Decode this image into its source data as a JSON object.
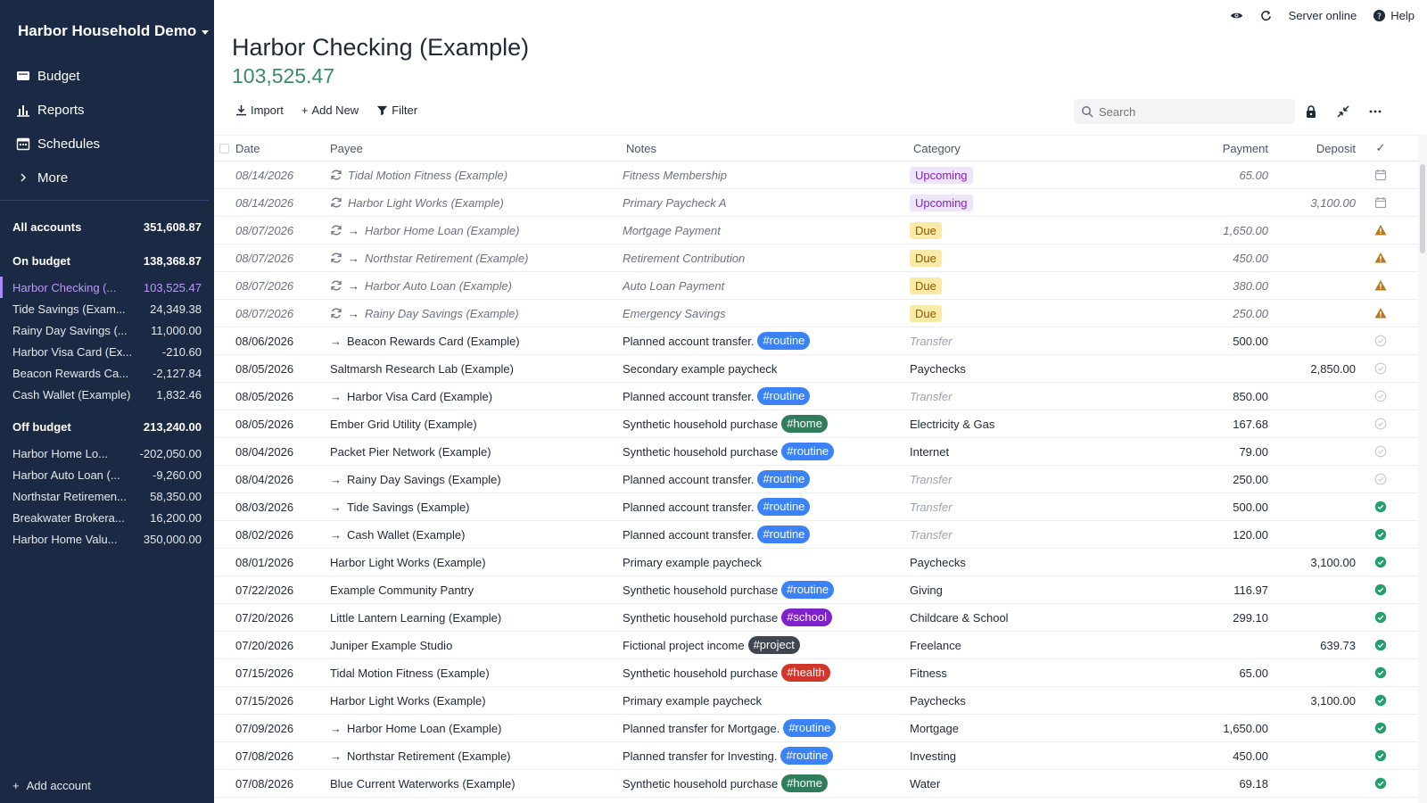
{
  "sidebar": {
    "budget_name": "Harbor Household Demo",
    "nav": [
      {
        "label": "Budget",
        "icon": "wallet-icon"
      },
      {
        "label": "Reports",
        "icon": "bar-chart-icon"
      },
      {
        "label": "Schedules",
        "icon": "calendar-icon"
      },
      {
        "label": "More",
        "icon": "chevron-right-icon"
      }
    ],
    "all_accounts": {
      "label": "All accounts",
      "balance": "351,608.87"
    },
    "on_budget": {
      "label": "On budget",
      "balance": "138,368.87"
    },
    "on_budget_accounts": [
      {
        "name": "Harbor Checking (...",
        "balance": "103,525.47",
        "selected": true
      },
      {
        "name": "Tide Savings (Exam...",
        "balance": "24,349.38"
      },
      {
        "name": "Rainy Day Savings (...",
        "balance": "11,000.00"
      },
      {
        "name": "Harbor Visa Card (Ex...",
        "balance": "-210.60"
      },
      {
        "name": "Beacon Rewards Ca...",
        "balance": "-2,127.84"
      },
      {
        "name": "Cash Wallet (Example)",
        "balance": "1,832.46"
      }
    ],
    "off_budget": {
      "label": "Off budget",
      "balance": "213,240.00"
    },
    "off_budget_accounts": [
      {
        "name": "Harbor Home Lo...",
        "balance": "-202,050.00"
      },
      {
        "name": "Harbor Auto Loan (...",
        "balance": "-9,260.00"
      },
      {
        "name": "Northstar Retiremen...",
        "balance": "58,350.00"
      },
      {
        "name": "Breakwater Brokera...",
        "balance": "16,200.00"
      },
      {
        "name": "Harbor Home Valu...",
        "balance": "350,000.00"
      }
    ],
    "add_account": "Add account"
  },
  "topbar": {
    "server_status": "Server online",
    "help": "Help"
  },
  "header": {
    "title": "Harbor Checking (Example)",
    "balance": "103,525.47"
  },
  "toolbar": {
    "import": "Import",
    "add_new": "Add New",
    "filter": "Filter",
    "search_placeholder": "Search"
  },
  "columns": {
    "date": "Date",
    "payee": "Payee",
    "notes": "Notes",
    "category": "Category",
    "payment": "Payment",
    "deposit": "Deposit",
    "cleared": "✓"
  },
  "colors": {
    "routine": "#3b82f6",
    "home": "#2f7d5b",
    "school": "#7e22ce",
    "project": "#3f4651",
    "health": "#d1362b",
    "cleared": "#22a06b",
    "warning": "#b7791f"
  },
  "rows": [
    {
      "date": "08/14/2026",
      "schedule": true,
      "transfer": false,
      "payee": "Tidal Motion Fitness (Example)",
      "notes": "Fitness Membership",
      "tag": "",
      "tag_color": "",
      "category": "Upcoming",
      "cat_type": "upcoming",
      "payment": "65.00",
      "deposit": "",
      "status": "calendar"
    },
    {
      "date": "08/14/2026",
      "schedule": true,
      "transfer": false,
      "payee": "Harbor Light Works (Example)",
      "notes": "Primary Paycheck A",
      "tag": "",
      "tag_color": "",
      "category": "Upcoming",
      "cat_type": "upcoming",
      "payment": "",
      "deposit": "3,100.00",
      "status": "calendar"
    },
    {
      "date": "08/07/2026",
      "schedule": true,
      "transfer": true,
      "payee": "Harbor Home Loan (Example)",
      "notes": "Mortgage Payment",
      "tag": "",
      "tag_color": "",
      "category": "Due",
      "cat_type": "due",
      "payment": "1,650.00",
      "deposit": "",
      "status": "warning"
    },
    {
      "date": "08/07/2026",
      "schedule": true,
      "transfer": true,
      "payee": "Northstar Retirement (Example)",
      "notes": "Retirement Contribution",
      "tag": "",
      "tag_color": "",
      "category": "Due",
      "cat_type": "due",
      "payment": "450.00",
      "deposit": "",
      "status": "warning"
    },
    {
      "date": "08/07/2026",
      "schedule": true,
      "transfer": true,
      "payee": "Harbor Auto Loan (Example)",
      "notes": "Auto Loan Payment",
      "tag": "",
      "tag_color": "",
      "category": "Due",
      "cat_type": "due",
      "payment": "380.00",
      "deposit": "",
      "status": "warning"
    },
    {
      "date": "08/07/2026",
      "schedule": true,
      "transfer": true,
      "payee": "Rainy Day Savings (Example)",
      "notes": "Emergency Savings",
      "tag": "",
      "tag_color": "",
      "category": "Due",
      "cat_type": "due",
      "payment": "250.00",
      "deposit": "",
      "status": "warning"
    },
    {
      "date": "08/06/2026",
      "schedule": false,
      "transfer": true,
      "payee": "Beacon Rewards Card (Example)",
      "notes": "Planned account transfer.",
      "tag": "#routine",
      "tag_color": "#3b82f6",
      "category": "Transfer",
      "cat_type": "transfer",
      "payment": "500.00",
      "deposit": "",
      "status": "uncleared"
    },
    {
      "date": "08/05/2026",
      "schedule": false,
      "transfer": false,
      "payee": "Saltmarsh Research Lab (Example)",
      "notes": "Secondary example paycheck",
      "tag": "",
      "tag_color": "",
      "category": "Paychecks",
      "cat_type": "normal",
      "payment": "",
      "deposit": "2,850.00",
      "status": "uncleared"
    },
    {
      "date": "08/05/2026",
      "schedule": false,
      "transfer": true,
      "payee": "Harbor Visa Card (Example)",
      "notes": "Planned account transfer.",
      "tag": "#routine",
      "tag_color": "#3b82f6",
      "category": "Transfer",
      "cat_type": "transfer",
      "payment": "850.00",
      "deposit": "",
      "status": "uncleared"
    },
    {
      "date": "08/05/2026",
      "schedule": false,
      "transfer": false,
      "payee": "Ember Grid Utility (Example)",
      "notes": "Synthetic household purchase",
      "tag": "#home",
      "tag_color": "#2f7d5b",
      "category": "Electricity & Gas",
      "cat_type": "normal",
      "payment": "167.68",
      "deposit": "",
      "status": "uncleared"
    },
    {
      "date": "08/04/2026",
      "schedule": false,
      "transfer": false,
      "payee": "Packet Pier Network (Example)",
      "notes": "Synthetic household purchase",
      "tag": "#routine",
      "tag_color": "#3b82f6",
      "category": "Internet",
      "cat_type": "normal",
      "payment": "79.00",
      "deposit": "",
      "status": "uncleared"
    },
    {
      "date": "08/04/2026",
      "schedule": false,
      "transfer": true,
      "payee": "Rainy Day Savings (Example)",
      "notes": "Planned account transfer.",
      "tag": "#routine",
      "tag_color": "#3b82f6",
      "category": "Transfer",
      "cat_type": "transfer",
      "payment": "250.00",
      "deposit": "",
      "status": "uncleared"
    },
    {
      "date": "08/03/2026",
      "schedule": false,
      "transfer": true,
      "payee": "Tide Savings (Example)",
      "notes": "Planned account transfer.",
      "tag": "#routine",
      "tag_color": "#3b82f6",
      "category": "Transfer",
      "cat_type": "transfer",
      "payment": "500.00",
      "deposit": "",
      "status": "cleared"
    },
    {
      "date": "08/02/2026",
      "schedule": false,
      "transfer": true,
      "payee": "Cash Wallet (Example)",
      "notes": "Planned account transfer.",
      "tag": "#routine",
      "tag_color": "#3b82f6",
      "category": "Transfer",
      "cat_type": "transfer",
      "payment": "120.00",
      "deposit": "",
      "status": "cleared"
    },
    {
      "date": "08/01/2026",
      "schedule": false,
      "transfer": false,
      "payee": "Harbor Light Works (Example)",
      "notes": "Primary example paycheck",
      "tag": "",
      "tag_color": "",
      "category": "Paychecks",
      "cat_type": "normal",
      "payment": "",
      "deposit": "3,100.00",
      "status": "cleared"
    },
    {
      "date": "07/22/2026",
      "schedule": false,
      "transfer": false,
      "payee": "Example Community Pantry",
      "notes": "Synthetic household purchase",
      "tag": "#routine",
      "tag_color": "#3b82f6",
      "category": "Giving",
      "cat_type": "normal",
      "payment": "116.97",
      "deposit": "",
      "status": "cleared"
    },
    {
      "date": "07/20/2026",
      "schedule": false,
      "transfer": false,
      "payee": "Little Lantern Learning (Example)",
      "notes": "Synthetic household purchase",
      "tag": "#school",
      "tag_color": "#7e22ce",
      "category": "Childcare & School",
      "cat_type": "normal",
      "payment": "299.10",
      "deposit": "",
      "status": "cleared"
    },
    {
      "date": "07/20/2026",
      "schedule": false,
      "transfer": false,
      "payee": "Juniper Example Studio",
      "notes": "Fictional project income",
      "tag": "#project",
      "tag_color": "#3f4651",
      "category": "Freelance",
      "cat_type": "normal",
      "payment": "",
      "deposit": "639.73",
      "status": "cleared"
    },
    {
      "date": "07/15/2026",
      "schedule": false,
      "transfer": false,
      "payee": "Tidal Motion Fitness (Example)",
      "notes": "Synthetic household purchase",
      "tag": "#health",
      "tag_color": "#d1362b",
      "category": "Fitness",
      "cat_type": "normal",
      "payment": "65.00",
      "deposit": "",
      "status": "cleared"
    },
    {
      "date": "07/15/2026",
      "schedule": false,
      "transfer": false,
      "payee": "Harbor Light Works (Example)",
      "notes": "Primary example paycheck",
      "tag": "",
      "tag_color": "",
      "category": "Paychecks",
      "cat_type": "normal",
      "payment": "",
      "deposit": "3,100.00",
      "status": "cleared"
    },
    {
      "date": "07/09/2026",
      "schedule": false,
      "transfer": true,
      "payee": "Harbor Home Loan (Example)",
      "notes": "Planned transfer for Mortgage.",
      "tag": "#routine",
      "tag_color": "#3b82f6",
      "category": "Mortgage",
      "cat_type": "normal",
      "payment": "1,650.00",
      "deposit": "",
      "status": "cleared"
    },
    {
      "date": "07/08/2026",
      "schedule": false,
      "transfer": true,
      "payee": "Northstar Retirement (Example)",
      "notes": "Planned transfer for Investing.",
      "tag": "#routine",
      "tag_color": "#3b82f6",
      "category": "Investing",
      "cat_type": "normal",
      "payment": "450.00",
      "deposit": "",
      "status": "cleared"
    },
    {
      "date": "07/08/2026",
      "schedule": false,
      "transfer": false,
      "payee": "Blue Current Waterworks (Example)",
      "notes": "Synthetic household purchase",
      "tag": "#home",
      "tag_color": "#2f7d5b",
      "category": "Water",
      "cat_type": "normal",
      "payment": "69.18",
      "deposit": "",
      "status": "cleared"
    }
  ]
}
